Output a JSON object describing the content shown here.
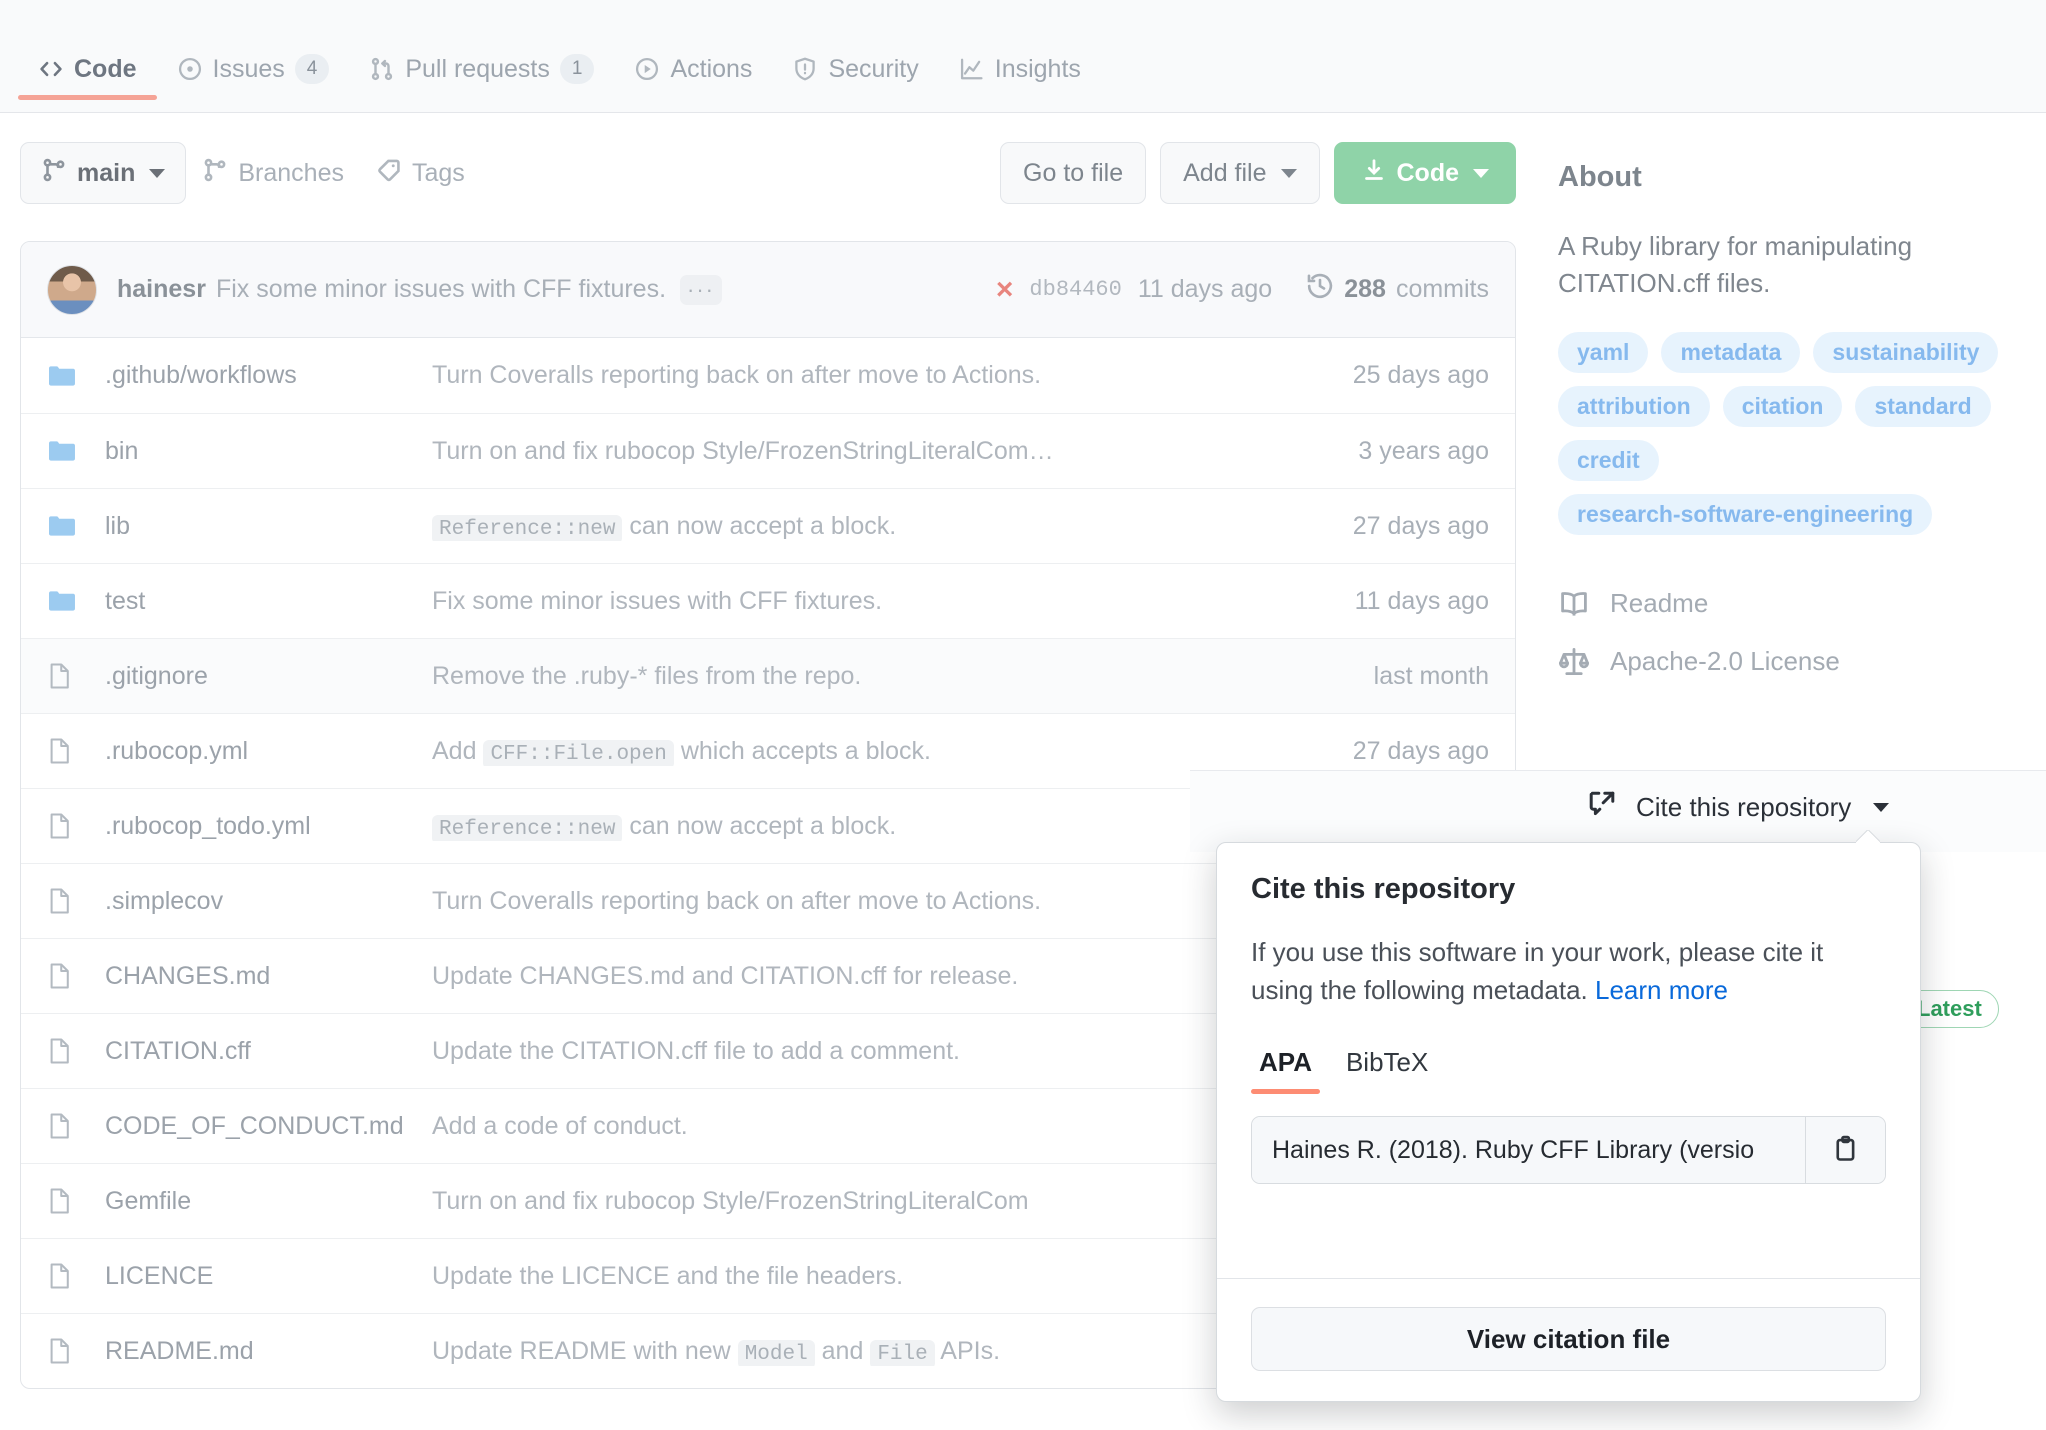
{
  "repo_nav": {
    "tabs": [
      {
        "label": "Code",
        "icon": "code-icon",
        "count": null,
        "active": true
      },
      {
        "label": "Issues",
        "icon": "issue-opened-icon",
        "count": "4",
        "active": false
      },
      {
        "label": "Pull requests",
        "icon": "git-pull-request-icon",
        "count": "1",
        "active": false
      },
      {
        "label": "Actions",
        "icon": "play-icon",
        "count": null,
        "active": false
      },
      {
        "label": "Security",
        "icon": "shield-icon",
        "count": null,
        "active": false
      },
      {
        "label": "Insights",
        "icon": "graph-icon",
        "count": null,
        "active": false
      }
    ]
  },
  "toolbar": {
    "branch": "main",
    "branches_label": "Branches",
    "tags_label": "Tags",
    "go_to_file": "Go to file",
    "add_file": "Add file",
    "code": "Code"
  },
  "commit_header": {
    "author": "hainesr",
    "message": "Fix some minor issues with CFF fixtures.",
    "ellipsis": "···",
    "status": "×",
    "sha": "db84460",
    "time": "11 days ago",
    "commits_count": "288",
    "commits_label": "commits"
  },
  "files": [
    {
      "type": "folder",
      "name": ".github/workflows",
      "message": "Turn Coveralls reporting back on after move to Actions.",
      "code": null,
      "message_tail": null,
      "time": "25 days ago"
    },
    {
      "type": "folder",
      "name": "bin",
      "message": "Turn on and fix rubocop Style/FrozenStringLiteralCom…",
      "code": null,
      "message_tail": null,
      "time": "3 years ago"
    },
    {
      "type": "folder",
      "name": "lib",
      "message": "",
      "code": "Reference::new",
      "message_tail": " can now accept a block.",
      "time": "27 days ago"
    },
    {
      "type": "folder",
      "name": "test",
      "message": "Fix some minor issues with CFF fixtures.",
      "code": null,
      "message_tail": null,
      "time": "11 days ago"
    },
    {
      "type": "file",
      "name": ".gitignore",
      "message": "Remove the .ruby-* files from the repo.",
      "code": null,
      "message_tail": null,
      "time": "last month"
    },
    {
      "type": "file",
      "name": ".rubocop.yml",
      "message": "Add ",
      "code": "CFF::File.open",
      "message_tail": " which accepts a block.",
      "time": "27 days ago"
    },
    {
      "type": "file",
      "name": ".rubocop_todo.yml",
      "message": "",
      "code": "Reference::new",
      "message_tail": " can now accept a block.",
      "time": ""
    },
    {
      "type": "file",
      "name": ".simplecov",
      "message": "Turn Coveralls reporting back on after move to Actions.",
      "code": null,
      "message_tail": null,
      "time": ""
    },
    {
      "type": "file",
      "name": "CHANGES.md",
      "message": "Update CHANGES.md and CITATION.cff for release.",
      "code": null,
      "message_tail": null,
      "time": ""
    },
    {
      "type": "file",
      "name": "CITATION.cff",
      "message": "Update the CITATION.cff file to add a comment.",
      "code": null,
      "message_tail": null,
      "time": ""
    },
    {
      "type": "file",
      "name": "CODE_OF_CONDUCT.md",
      "message": "Add a code of conduct.",
      "code": null,
      "message_tail": null,
      "time": ""
    },
    {
      "type": "file",
      "name": "Gemfile",
      "message": "Turn on and fix rubocop Style/FrozenStringLiteralCom",
      "code": null,
      "message_tail": null,
      "time": ""
    },
    {
      "type": "file",
      "name": "LICENCE",
      "message": "Update the LICENCE and the file headers.",
      "code": null,
      "message_tail": null,
      "time": ""
    },
    {
      "type": "file",
      "name": "README.md",
      "message": "Update README with new ",
      "code": "Model",
      "message_tail": " and ",
      "code2": "File",
      "message_tail2": " APIs.",
      "time": ""
    }
  ],
  "about": {
    "title": "About",
    "description": "A Ruby library for manipulating CITATION.cff files.",
    "topics": [
      "yaml",
      "metadata",
      "sustainability",
      "attribution",
      "citation",
      "standard",
      "credit",
      "research-software-engineering"
    ],
    "links": [
      {
        "label": "Readme",
        "icon": "book-icon"
      },
      {
        "label": "Apache-2.0 License",
        "icon": "law-icon"
      },
      {
        "label": "Cite this repository",
        "icon": "cross-reference-icon"
      }
    ],
    "latest_badge": "Latest"
  },
  "cite_popover": {
    "title": "Cite this repository",
    "body_text": "If you use this software in your work, please cite it using the following metadata. ",
    "learn_more": "Learn more",
    "tabs": [
      "APA",
      "BibTeX"
    ],
    "active_tab": "APA",
    "citation_value": "Haines R. (2018). Ruby CFF Library (versio",
    "copy_icon": "clipboard-icon",
    "view_citation_file": "View citation file"
  },
  "colors": {
    "accent_underline": "#f5a396",
    "popover_tab_underline": "#fd8c73",
    "code_button": "#8fd3a8",
    "link": "#0969da",
    "topic_bg": "#e7f3fd",
    "topic_text": "#86b9ee",
    "fail_x": "#e8857e",
    "latest_green": "#2f9e5c"
  }
}
